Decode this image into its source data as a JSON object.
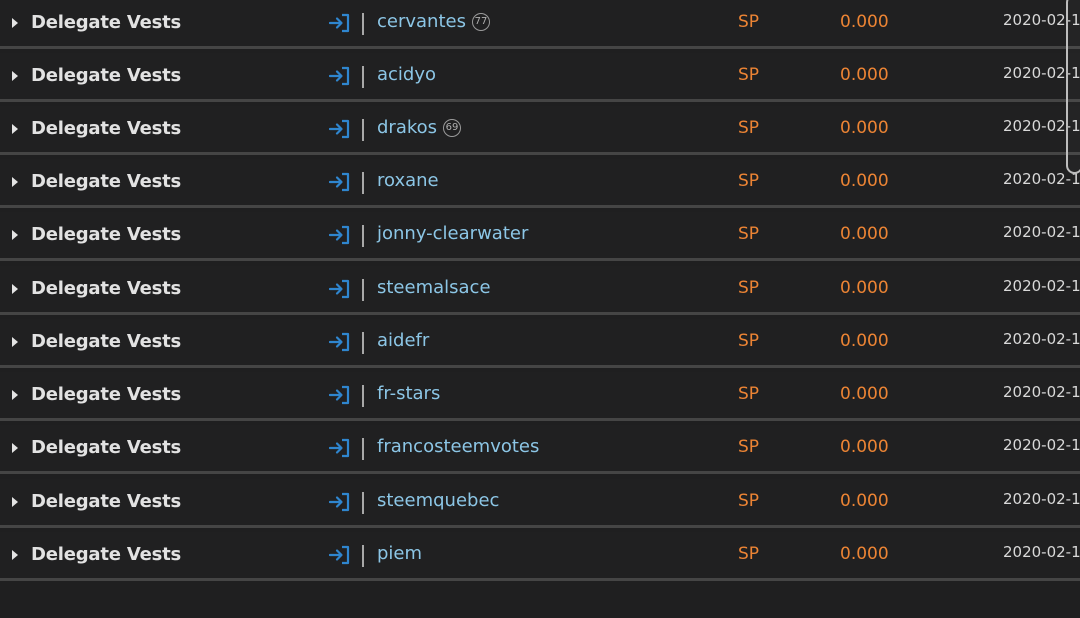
{
  "rows": [
    {
      "operation": "Delegate Vests",
      "direction_icon": "sign-in-arrow-icon",
      "user": "cervantes",
      "reputation": "77",
      "unit": "SP",
      "amount": "0.000",
      "date": "2020-02-1"
    },
    {
      "operation": "Delegate Vests",
      "direction_icon": "sign-in-arrow-icon",
      "user": "acidyo",
      "reputation": null,
      "unit": "SP",
      "amount": "0.000",
      "date": "2020-02-1"
    },
    {
      "operation": "Delegate Vests",
      "direction_icon": "sign-in-arrow-icon",
      "user": "drakos",
      "reputation": "69",
      "unit": "SP",
      "amount": "0.000",
      "date": "2020-02-1"
    },
    {
      "operation": "Delegate Vests",
      "direction_icon": "sign-in-arrow-icon",
      "user": "roxane",
      "reputation": null,
      "unit": "SP",
      "amount": "0.000",
      "date": "2020-02-1"
    },
    {
      "operation": "Delegate Vests",
      "direction_icon": "sign-in-arrow-icon",
      "user": "jonny-clearwater",
      "reputation": null,
      "unit": "SP",
      "amount": "0.000",
      "date": "2020-02-1"
    },
    {
      "operation": "Delegate Vests",
      "direction_icon": "sign-in-arrow-icon",
      "user": "steemalsace",
      "reputation": null,
      "unit": "SP",
      "amount": "0.000",
      "date": "2020-02-1"
    },
    {
      "operation": "Delegate Vests",
      "direction_icon": "sign-in-arrow-icon",
      "user": "aidefr",
      "reputation": null,
      "unit": "SP",
      "amount": "0.000",
      "date": "2020-02-1"
    },
    {
      "operation": "Delegate Vests",
      "direction_icon": "sign-in-arrow-icon",
      "user": "fr-stars",
      "reputation": null,
      "unit": "SP",
      "amount": "0.000",
      "date": "2020-02-1"
    },
    {
      "operation": "Delegate Vests",
      "direction_icon": "sign-in-arrow-icon",
      "user": "francosteemvotes",
      "reputation": null,
      "unit": "SP",
      "amount": "0.000",
      "date": "2020-02-1"
    },
    {
      "operation": "Delegate Vests",
      "direction_icon": "sign-in-arrow-icon",
      "user": "steemquebec",
      "reputation": null,
      "unit": "SP",
      "amount": "0.000",
      "date": "2020-02-1"
    },
    {
      "operation": "Delegate Vests",
      "direction_icon": "sign-in-arrow-icon",
      "user": "piem",
      "reputation": null,
      "unit": "SP",
      "amount": "0.000",
      "date": "2020-02-1"
    }
  ],
  "colors": {
    "background": "#1f1f20",
    "row_divider": "#454545",
    "operation_text": "#e2e2e2",
    "username": "#8cc6e6",
    "amount": "#ec8434",
    "icon_blue": "#2f86cf"
  }
}
